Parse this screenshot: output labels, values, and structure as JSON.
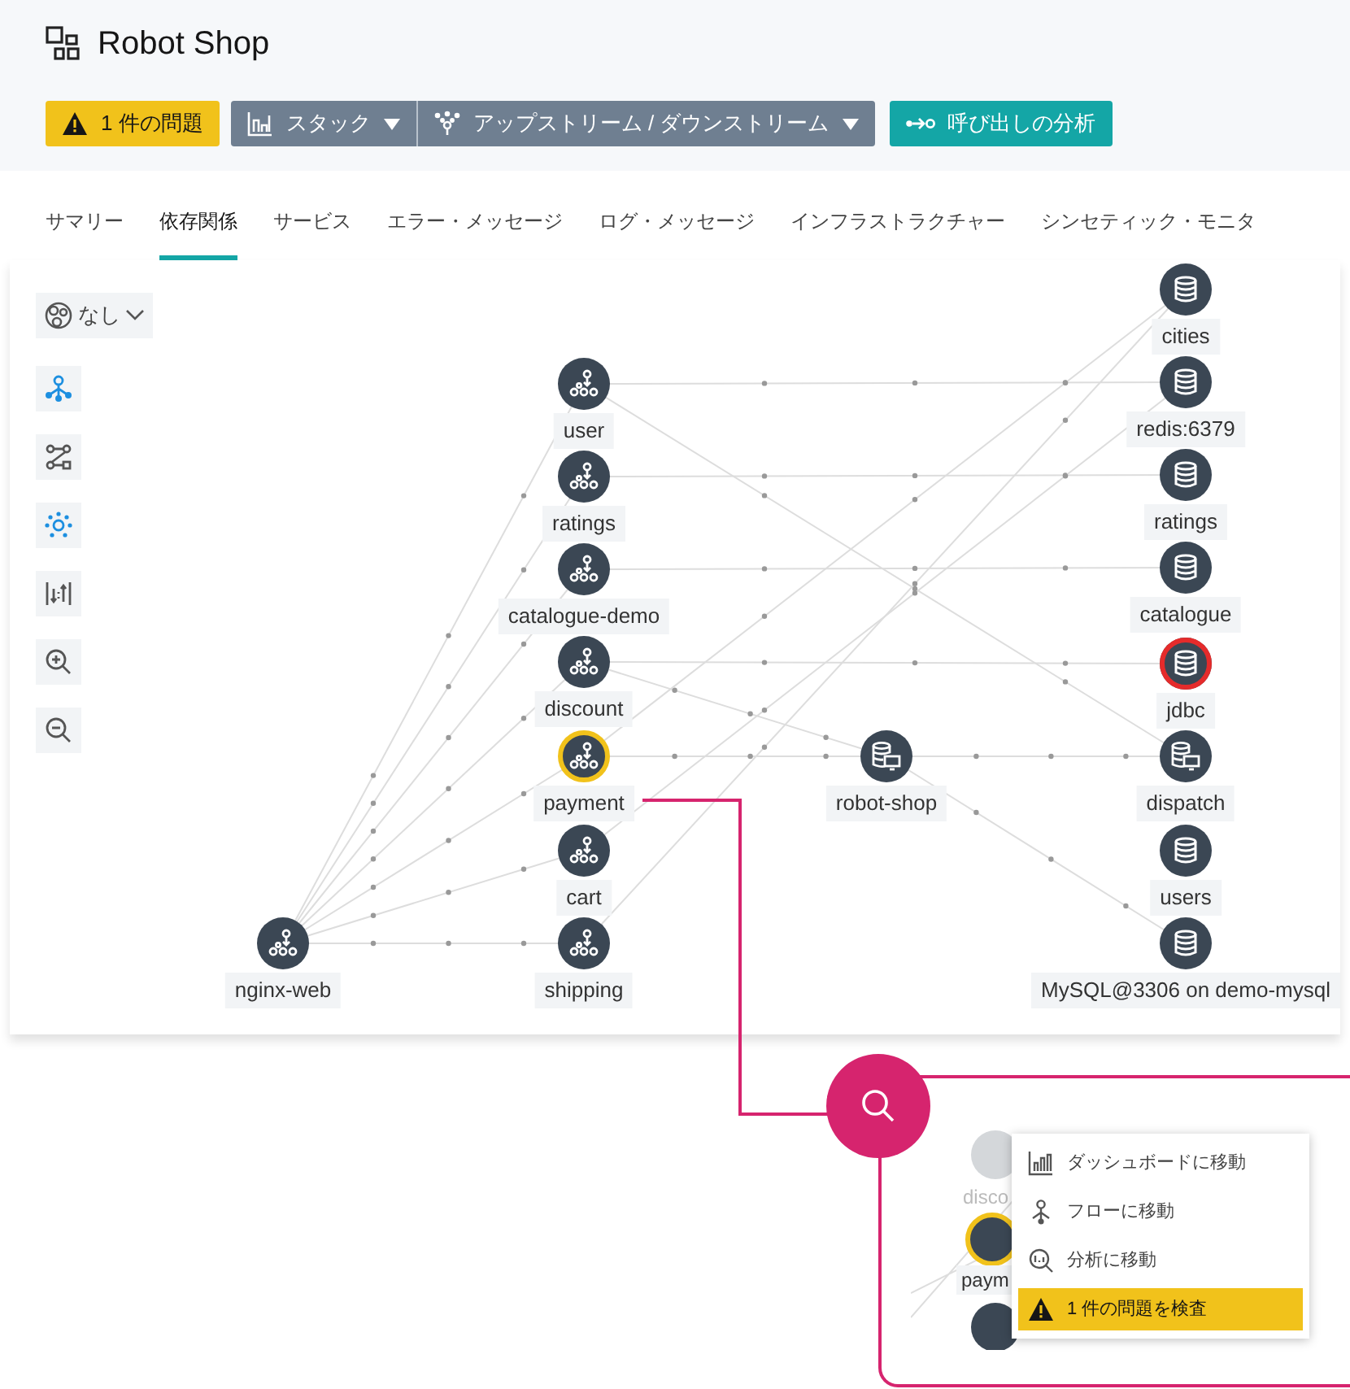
{
  "header": {
    "title": "Robot Shop"
  },
  "toolbar": {
    "issues": {
      "label": "1 件の問題"
    },
    "stack": {
      "label": "スタック"
    },
    "direction": {
      "label": "アップストリーム / ダウンストリーム"
    },
    "analyze": {
      "label": "呼び出しの分析"
    }
  },
  "tabs": [
    {
      "label": "サマリー",
      "selected": false
    },
    {
      "label": "依存関係",
      "selected": true
    },
    {
      "label": "サービス",
      "selected": false
    },
    {
      "label": "エラー・メッセージ",
      "selected": false
    },
    {
      "label": "ログ・メッセージ",
      "selected": false
    },
    {
      "label": "インフラストラクチャー",
      "selected": false
    },
    {
      "label": "シンセティック・モニタ",
      "selected": false
    }
  ],
  "graph": {
    "grouping": {
      "label": "なし"
    },
    "tools": [
      {
        "kind": "flow",
        "selected": true
      },
      {
        "kind": "route",
        "selected": false
      },
      {
        "kind": "cluster",
        "selected": true
      },
      {
        "kind": "sort",
        "selected": false
      },
      {
        "kind": "zoom-in",
        "selected": false
      },
      {
        "kind": "zoom-out",
        "selected": false
      }
    ],
    "nodes": [
      {
        "label": "nginx-web",
        "kind": "service",
        "warning": false,
        "error": false
      },
      {
        "label": "user",
        "kind": "service",
        "warning": false,
        "error": false
      },
      {
        "label": "ratings",
        "kind": "service",
        "warning": false,
        "error": false
      },
      {
        "label": "catalogue-demo",
        "kind": "service",
        "warning": false,
        "error": false
      },
      {
        "label": "discount",
        "kind": "service",
        "warning": false,
        "error": false
      },
      {
        "label": "payment",
        "kind": "service",
        "warning": true,
        "error": false
      },
      {
        "label": "cart",
        "kind": "service",
        "warning": false,
        "error": false
      },
      {
        "label": "shipping",
        "kind": "service",
        "warning": false,
        "error": false
      },
      {
        "label": "robot-shop",
        "kind": "host",
        "warning": false,
        "error": false
      },
      {
        "label": "cities",
        "kind": "database",
        "warning": false,
        "error": false
      },
      {
        "label": "redis:6379",
        "kind": "database",
        "warning": false,
        "error": false
      },
      {
        "label": "ratings",
        "kind": "database",
        "warning": false,
        "error": false
      },
      {
        "label": "catalogue",
        "kind": "database",
        "warning": false,
        "error": false
      },
      {
        "label": "jdbc",
        "kind": "database",
        "warning": false,
        "error": true
      },
      {
        "label": "dispatch",
        "kind": "host",
        "warning": false,
        "error": false
      },
      {
        "label": "users",
        "kind": "database",
        "warning": false,
        "error": false
      },
      {
        "label": "MySQL@3306 on demo-mysql",
        "kind": "database",
        "warning": false,
        "error": false
      }
    ]
  },
  "callout": {
    "preview_labels": [
      "disco",
      "paym"
    ],
    "menu": [
      {
        "label": "ダッシュボードに移動",
        "kind": "dashboard",
        "selected": false
      },
      {
        "label": "フローに移動",
        "kind": "flow",
        "selected": false
      },
      {
        "label": "分析に移動",
        "kind": "analysis",
        "selected": false
      },
      {
        "label": "1 件の問題を検査",
        "kind": "issue",
        "selected": true
      }
    ]
  }
}
